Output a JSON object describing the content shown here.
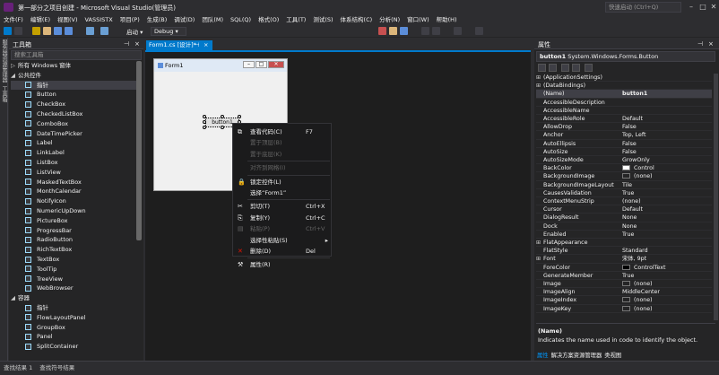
{
  "window": {
    "title": "第一部分之项目创建 - Microsoft Visual Studio(管理员)",
    "quick_launch_placeholder": "快速启动 (Ctrl+Q)"
  },
  "menu": [
    "文件(F)",
    "编辑(E)",
    "视图(V)",
    "VASSISTX",
    "项目(P)",
    "生成(B)",
    "调试(D)",
    "团队(M)",
    "SQL(Q)",
    "格式(O)",
    "工具(T)",
    "测试(S)",
    "体系结构(C)",
    "分析(N)",
    "窗口(W)",
    "帮助(H)"
  ],
  "toolbar": {
    "start_label": "启动 ▾",
    "config": "Debug ▾"
  },
  "left_strip": [
    "服务器资源管理器",
    "工具箱"
  ],
  "toolbox": {
    "title": "工具箱",
    "search_placeholder": "搜索工具箱",
    "items": [
      {
        "label": "所有 Windows 窗体",
        "kind": "cat",
        "expanded": false
      },
      {
        "label": "公共控件",
        "kind": "cat",
        "expanded": true
      },
      {
        "label": "指针",
        "kind": "item",
        "selected": true
      },
      {
        "label": "Button",
        "kind": "item"
      },
      {
        "label": "CheckBox",
        "kind": "item"
      },
      {
        "label": "CheckedListBox",
        "kind": "item"
      },
      {
        "label": "ComboBox",
        "kind": "item"
      },
      {
        "label": "DateTimePicker",
        "kind": "item"
      },
      {
        "label": "Label",
        "kind": "item"
      },
      {
        "label": "LinkLabel",
        "kind": "item"
      },
      {
        "label": "ListBox",
        "kind": "item"
      },
      {
        "label": "ListView",
        "kind": "item"
      },
      {
        "label": "MaskedTextBox",
        "kind": "item"
      },
      {
        "label": "MonthCalendar",
        "kind": "item"
      },
      {
        "label": "NotifyIcon",
        "kind": "item"
      },
      {
        "label": "NumericUpDown",
        "kind": "item"
      },
      {
        "label": "PictureBox",
        "kind": "item"
      },
      {
        "label": "ProgressBar",
        "kind": "item"
      },
      {
        "label": "RadioButton",
        "kind": "item"
      },
      {
        "label": "RichTextBox",
        "kind": "item"
      },
      {
        "label": "TextBox",
        "kind": "item"
      },
      {
        "label": "ToolTip",
        "kind": "item"
      },
      {
        "label": "TreeView",
        "kind": "item"
      },
      {
        "label": "WebBrowser",
        "kind": "item"
      },
      {
        "label": "容器",
        "kind": "cat",
        "expanded": true
      },
      {
        "label": "指针",
        "kind": "item"
      },
      {
        "label": "FlowLayoutPanel",
        "kind": "item"
      },
      {
        "label": "GroupBox",
        "kind": "item"
      },
      {
        "label": "Panel",
        "kind": "item"
      },
      {
        "label": "SplitContainer",
        "kind": "item"
      }
    ]
  },
  "document": {
    "tab_label": "Form1.cs [设计]*",
    "tab_pin": "⊣",
    "tab_close": "×",
    "form_title": "Form1",
    "button_text": "button1"
  },
  "context_menu": {
    "items": [
      {
        "icon": "code-icon",
        "label": "查看代码(C)",
        "shortcut": "F7",
        "disabled": false
      },
      {
        "icon": "",
        "label": "置于顶层(B)",
        "shortcut": "",
        "disabled": true
      },
      {
        "icon": "",
        "label": "置于底层(K)",
        "shortcut": "",
        "disabled": true
      },
      {
        "sep": true
      },
      {
        "icon": "",
        "label": "对齐到网格(I)",
        "shortcut": "",
        "disabled": true
      },
      {
        "sep": true
      },
      {
        "icon": "lock-icon",
        "label": "锁定控件(L)",
        "shortcut": "",
        "disabled": false
      },
      {
        "icon": "",
        "label": "选择“Form1”",
        "shortcut": "",
        "disabled": false
      },
      {
        "sep": true
      },
      {
        "icon": "cut-icon",
        "label": "剪切(T)",
        "shortcut": "Ctrl+X",
        "disabled": false
      },
      {
        "icon": "copy-icon",
        "label": "复制(Y)",
        "shortcut": "Ctrl+C",
        "disabled": false
      },
      {
        "icon": "paste-icon",
        "label": "粘贴(P)",
        "shortcut": "Ctrl+V",
        "disabled": true
      },
      {
        "icon": "",
        "label": "选择性粘贴(S)",
        "shortcut": "",
        "disabled": false,
        "submenu": true
      },
      {
        "icon": "delete-icon",
        "label": "删除(D)",
        "shortcut": "Del",
        "disabled": false
      },
      {
        "sep": true
      },
      {
        "icon": "wrench-icon",
        "label": "属性(R)",
        "shortcut": "",
        "disabled": false
      }
    ]
  },
  "properties": {
    "title": "属性",
    "object_name": "button1",
    "object_type": "System.Windows.Forms.Button",
    "rows": [
      {
        "name": "(ApplicationSettings)",
        "value": "",
        "expander": true
      },
      {
        "name": "(DataBindings)",
        "value": "",
        "expander": true
      },
      {
        "name": "(Name)",
        "value": "button1",
        "selected": true
      },
      {
        "name": "AccessibleDescription",
        "value": ""
      },
      {
        "name": "AccessibleName",
        "value": ""
      },
      {
        "name": "AccessibleRole",
        "value": "Default"
      },
      {
        "name": "AllowDrop",
        "value": "False"
      },
      {
        "name": "Anchor",
        "value": "Top, Left"
      },
      {
        "name": "AutoEllipsis",
        "value": "False"
      },
      {
        "name": "AutoSize",
        "value": "False"
      },
      {
        "name": "AutoSizeMode",
        "value": "GrowOnly"
      },
      {
        "name": "BackColor",
        "value": "Control",
        "swatch": "#ffffff"
      },
      {
        "name": "BackgroundImage",
        "value": "(none)",
        "swatch": "#252526"
      },
      {
        "name": "BackgroundImageLayout",
        "value": "Tile"
      },
      {
        "name": "CausesValidation",
        "value": "True"
      },
      {
        "name": "ContextMenuStrip",
        "value": "(none)"
      },
      {
        "name": "Cursor",
        "value": "Default"
      },
      {
        "name": "DialogResult",
        "value": "None"
      },
      {
        "name": "Dock",
        "value": "None"
      },
      {
        "name": "Enabled",
        "value": "True"
      },
      {
        "name": "FlatAppearance",
        "value": "",
        "expander": true
      },
      {
        "name": "FlatStyle",
        "value": "Standard"
      },
      {
        "name": "Font",
        "value": "宋体, 9pt",
        "expander": true
      },
      {
        "name": "ForeColor",
        "value": "ControlText",
        "swatch": "#000000"
      },
      {
        "name": "GenerateMember",
        "value": "True"
      },
      {
        "name": "Image",
        "value": "(none)",
        "swatch": "#252526"
      },
      {
        "name": "ImageAlign",
        "value": "MiddleCenter"
      },
      {
        "name": "ImageIndex",
        "value": "(none)",
        "swatch": "#252526"
      },
      {
        "name": "ImageKey",
        "value": "(none)",
        "swatch": "#252526"
      }
    ],
    "desc_name": "(Name)",
    "desc_text": "Indicates the name used in code to identify the object.",
    "tabs": [
      "属性",
      "解决方案资源管理器",
      "类视图"
    ]
  },
  "bottom_tabs": [
    "查找结果 1",
    "查找符号结果"
  ],
  "colors": {
    "accent": "#007acc",
    "bg": "#2d2d30",
    "panel": "#252526",
    "editor": "#1e1e1e"
  }
}
